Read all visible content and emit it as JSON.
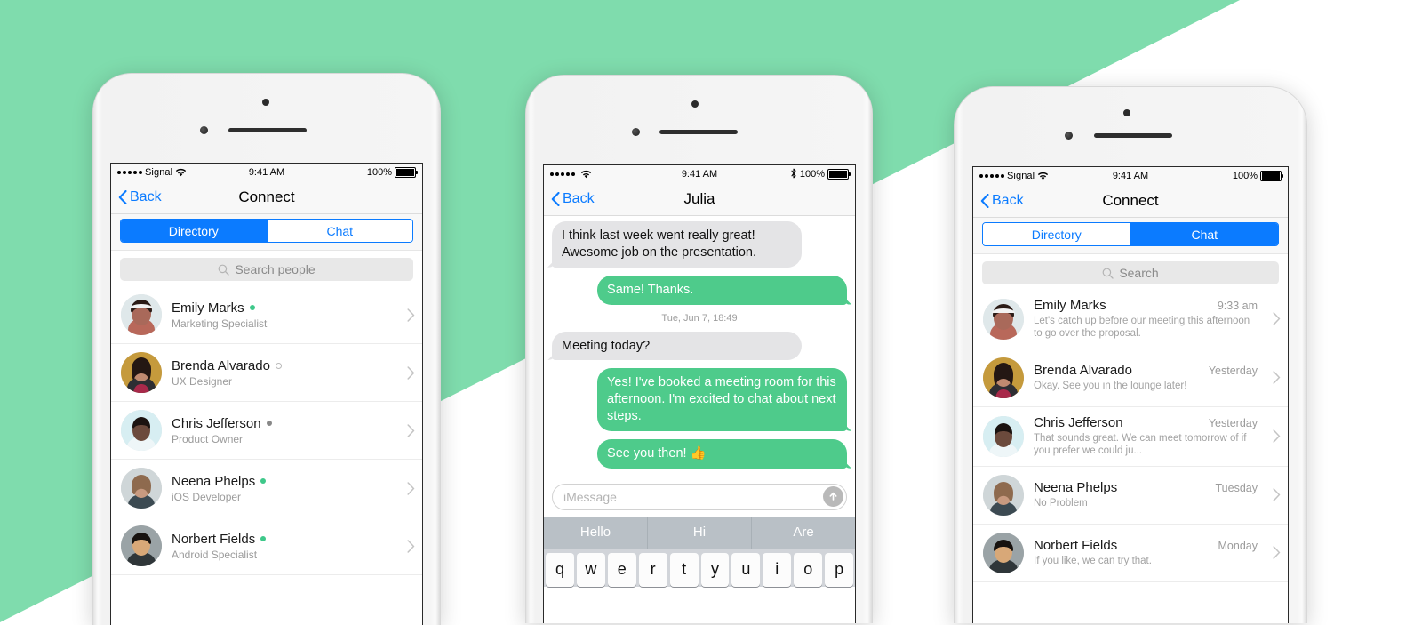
{
  "background": {
    "mint": "#7fdcad",
    "white": "#ffffff"
  },
  "theme": {
    "ios_blue": "#0b7bff",
    "bubble_green": "#4ecb8b",
    "online_green": "#3ec88a"
  },
  "phones": [
    {
      "id": "directory",
      "status_bar": {
        "carrier": "Signal",
        "time": "9:41 AM",
        "battery": "100%",
        "wifi_icon": "wifi-icon",
        "signal_icon": "signal-dots-icon",
        "battery_icon": "battery-full-icon"
      },
      "nav": {
        "back_label": "Back",
        "back_icon": "chevron-left-icon",
        "title": "Connect"
      },
      "segments": [
        {
          "label": "Directory",
          "active": true
        },
        {
          "label": "Chat",
          "active": false
        }
      ],
      "search": {
        "placeholder": "Search people",
        "icon": "search-icon"
      },
      "people": [
        {
          "name": "Emily Marks",
          "role": "Marketing Specialist",
          "status": "online",
          "chevron": "chevron-right-icon"
        },
        {
          "name": "Brenda Alvarado",
          "role": "UX Designer",
          "status": "offline",
          "chevron": "chevron-right-icon"
        },
        {
          "name": "Chris Jefferson",
          "role": "Product Owner",
          "status": "away",
          "chevron": "chevron-right-icon"
        },
        {
          "name": "Neena Phelps",
          "role": "iOS Developer",
          "status": "online",
          "chevron": "chevron-right-icon"
        },
        {
          "name": "Norbert Fields",
          "role": "Android Specialist",
          "status": "online",
          "chevron": "chevron-right-icon"
        }
      ]
    },
    {
      "id": "conversation",
      "status_bar": {
        "carrier": "",
        "time": "9:41 AM",
        "battery": "100%",
        "wifi_icon": "wifi-icon",
        "signal_icon": "signal-dots-icon",
        "bluetooth_icon": "bluetooth-icon",
        "battery_icon": "battery-full-icon"
      },
      "nav": {
        "back_label": "Back",
        "back_icon": "chevron-left-icon",
        "title": "Julia"
      },
      "messages": [
        {
          "side": "them",
          "text": "I think last week went really great! Awesome job on the presentation."
        },
        {
          "side": "me",
          "text": "Same! Thanks."
        },
        {
          "divider": "Tue, Jun 7, 18:49"
        },
        {
          "side": "them",
          "text": "Meeting today?"
        },
        {
          "side": "me",
          "text": "Yes! I've booked a meeting room for this afternoon. I'm excited to chat about next steps."
        },
        {
          "side": "me",
          "text": "See you then! 👍"
        }
      ],
      "composer": {
        "placeholder": "iMessage",
        "send_icon": "send-arrow-up-icon"
      },
      "keyboard": {
        "predictive": [
          "Hello",
          "Hi",
          "Are"
        ],
        "row1": [
          "q",
          "w",
          "e",
          "r",
          "t",
          "y",
          "u",
          "i",
          "o",
          "p"
        ]
      }
    },
    {
      "id": "chat-list",
      "status_bar": {
        "carrier": "Signal",
        "time": "9:41 AM",
        "battery": "100%",
        "wifi_icon": "wifi-icon",
        "signal_icon": "signal-dots-icon",
        "battery_icon": "battery-full-icon"
      },
      "nav": {
        "back_label": "Back",
        "back_icon": "chevron-left-icon",
        "title": "Connect"
      },
      "segments": [
        {
          "label": "Directory",
          "active": false
        },
        {
          "label": "Chat",
          "active": true
        }
      ],
      "search": {
        "placeholder": "Search",
        "icon": "search-icon"
      },
      "threads": [
        {
          "name": "Emily Marks",
          "time": "9:33 am",
          "preview": "Let's catch up before our meeting this afternoon to go over the proposal.",
          "chevron": "chevron-right-icon"
        },
        {
          "name": "Brenda Alvarado",
          "time": "Yesterday",
          "preview": "Okay. See you in the lounge later!",
          "chevron": "chevron-right-icon"
        },
        {
          "name": "Chris Jefferson",
          "time": "Yesterday",
          "preview": "That sounds great. We can meet tomorrow of if you prefer we could ju...",
          "chevron": "chevron-right-icon"
        },
        {
          "name": "Neena Phelps",
          "time": "Tuesday",
          "preview": "No Problem",
          "chevron": "chevron-right-icon"
        },
        {
          "name": "Norbert Fields",
          "time": "Monday",
          "preview": "If you like, we can try that.",
          "chevron": "chevron-right-icon"
        }
      ]
    }
  ]
}
